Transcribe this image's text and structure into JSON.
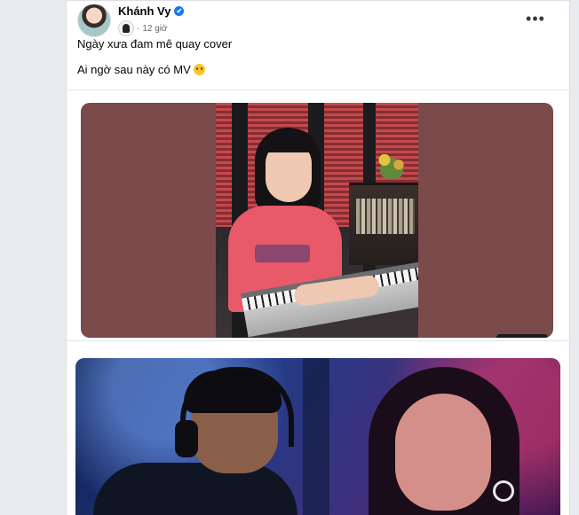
{
  "post": {
    "author": "Khánh Vy",
    "verified_mark": "✔",
    "time": "12 giờ",
    "dot": "·",
    "more": "•••",
    "lines": [
      "Ngày xưa đam mê quay cover",
      "Ai ngờ sau này có MV"
    ]
  },
  "icons": {
    "verified": "verified-badge-icon",
    "group": "group-avatar-icon",
    "more": "more-options-icon",
    "emoji": "pleading-face-emoji"
  },
  "colors": {
    "verified": "#1877f2",
    "meta_text": "#65676b",
    "card_bg": "#ffffff",
    "page_bg": "#e9ebee"
  }
}
